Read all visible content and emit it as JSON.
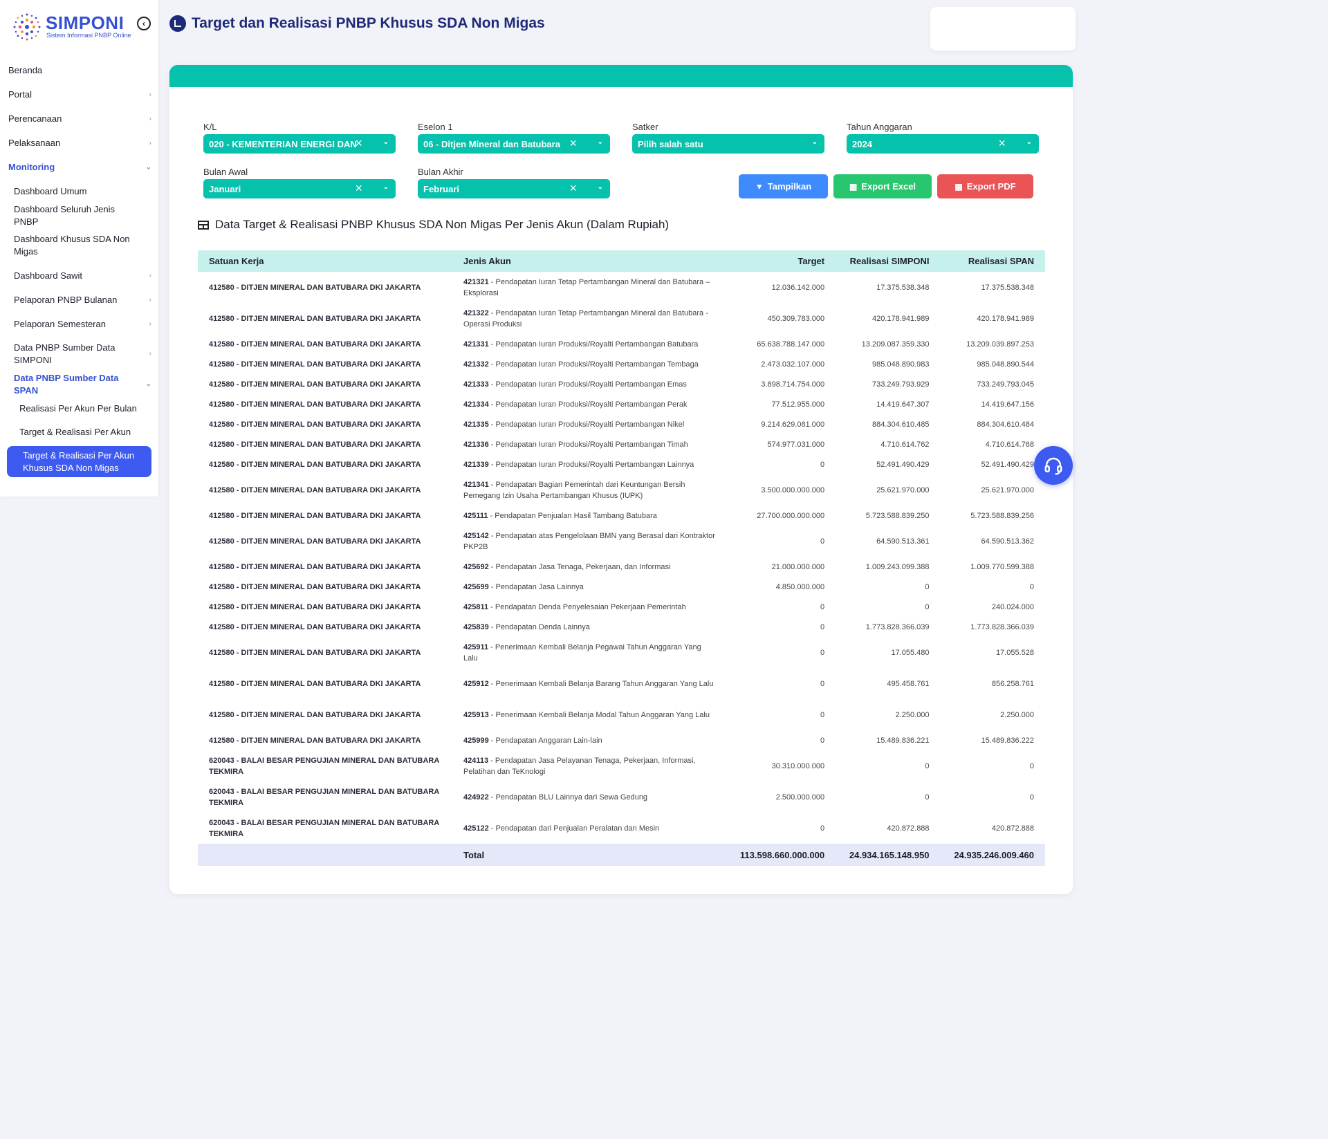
{
  "brand": {
    "name": "SIMPONI",
    "subtitle": "Sistem Informasi PNBP Online"
  },
  "sidebar": {
    "items": [
      {
        "label": "Beranda"
      },
      {
        "label": "Portal"
      },
      {
        "label": "Perencanaan"
      },
      {
        "label": "Pelaksanaan"
      },
      {
        "label": "Monitoring"
      }
    ],
    "monitoring": [
      {
        "label": "Dashboard Umum"
      },
      {
        "label": "Dashboard Seluruh Jenis PNBP"
      },
      {
        "label": "Dashboard Khusus SDA Non Migas"
      },
      {
        "label": "Dashboard Sawit"
      },
      {
        "label": "Pelaporan PNBP Bulanan"
      },
      {
        "label": "Pelaporan Semesteran"
      },
      {
        "label": "Data PNBP Sumber Data SIMPONI"
      },
      {
        "label": "Data PNBP Sumber Data SPAN"
      }
    ],
    "span": [
      {
        "label": "Realisasi Per Akun Per Bulan"
      },
      {
        "label": "Target & Realisasi Per Akun"
      },
      {
        "label": "Target & Realisasi Per Akun Khusus SDA Non Migas"
      }
    ]
  },
  "page": {
    "title": "Target dan Realisasi PNBP Khusus SDA Non Migas"
  },
  "filters": {
    "kl": {
      "label": "K/L",
      "value": "020 - KEMENTERIAN ENERGI DAN"
    },
    "eselon": {
      "label": "Eselon 1",
      "value": "06 - Ditjen Mineral dan Batubara"
    },
    "satker": {
      "label": "Satker",
      "value": "Pilih salah satu"
    },
    "tahun": {
      "label": "Tahun Anggaran",
      "value": "2024"
    },
    "bulan_awal": {
      "label": "Bulan Awal",
      "value": "Januari"
    },
    "bulan_akhir": {
      "label": "Bulan Akhir",
      "value": "Februari"
    }
  },
  "buttons": {
    "tampilkan": "Tampilkan",
    "excel": "Export Excel",
    "pdf": "Export PDF"
  },
  "section_title": "Data Target & Realisasi PNBP Khusus SDA Non Migas Per Jenis Akun (Dalam Rupiah)",
  "table": {
    "headers": [
      "Satuan Kerja",
      "Jenis Akun",
      "Target",
      "Realisasi SIMPONI",
      "Realisasi SPAN"
    ],
    "rows": [
      {
        "sk": "412580 - DITJEN MINERAL DAN BATUBARA DKI JAKARTA",
        "code": "421321",
        "name": "Pendapatan Iuran Tetap Pertambangan Mineral dan Batubara – Eksplorasi",
        "target": "12.036.142.000",
        "simponi": "17.375.538.348",
        "span": "17.375.538.348",
        "h": 45
      },
      {
        "sk": "412580 - DITJEN MINERAL DAN BATUBARA DKI JAKARTA",
        "code": "421322",
        "name": "Pendapatan Iuran Tetap Pertambangan Mineral dan Batubara - Operasi Produksi",
        "target": "450.309.783.000",
        "simponi": "420.178.941.989",
        "span": "420.178.941.989",
        "h": 45
      },
      {
        "sk": "412580 - DITJEN MINERAL DAN BATUBARA DKI JAKARTA",
        "code": "421331",
        "name": "Pendapatan Iuran Produksi/Royalti Pertambangan Batubara",
        "target": "65.638.788.147.000",
        "simponi": "13.209.087.359.330",
        "span": "13.209.039.897.253",
        "h": 29
      },
      {
        "sk": "412580 - DITJEN MINERAL DAN BATUBARA DKI JAKARTA",
        "code": "421332",
        "name": "Pendapatan Iuran Produksi/Royalti Pertambangan Tembaga",
        "target": "2.473.032.107.000",
        "simponi": "985.048.890.983",
        "span": "985.048.890.544",
        "h": 29
      },
      {
        "sk": "412580 - DITJEN MINERAL DAN BATUBARA DKI JAKARTA",
        "code": "421333",
        "name": "Pendapatan Iuran Produksi/Royalti Pertambangan Emas",
        "target": "3.898.714.754.000",
        "simponi": "733.249.793.929",
        "span": "733.249.793.045",
        "h": 29
      },
      {
        "sk": "412580 - DITJEN MINERAL DAN BATUBARA DKI JAKARTA",
        "code": "421334",
        "name": "Pendapatan Iuran Produksi/Royalti Pertambangan Perak",
        "target": "77.512.955.000",
        "simponi": "14.419.647.307",
        "span": "14.419.647.156",
        "h": 29
      },
      {
        "sk": "412580 - DITJEN MINERAL DAN BATUBARA DKI JAKARTA",
        "code": "421335",
        "name": "Pendapatan Iuran Produksi/Royalti Pertambangan Nikel",
        "target": "9.214.629.081.000",
        "simponi": "884.304.610.485",
        "span": "884.304.610.484",
        "h": 29
      },
      {
        "sk": "412580 - DITJEN MINERAL DAN BATUBARA DKI JAKARTA",
        "code": "421336",
        "name": "Pendapatan Iuran Produksi/Royalti Pertambangan Timah",
        "target": "574.977.031.000",
        "simponi": "4.710.614.762",
        "span": "4.710.614.768",
        "h": 29
      },
      {
        "sk": "412580 - DITJEN MINERAL DAN BATUBARA DKI JAKARTA",
        "code": "421339",
        "name": "Pendapatan Iuran Produksi/Royalti Pertambangan Lainnya",
        "target": "0",
        "simponi": "52.491.490.429",
        "span": "52.491.490.429",
        "h": 29
      },
      {
        "sk": "412580 - DITJEN MINERAL DAN BATUBARA DKI JAKARTA",
        "code": "421341",
        "name": "Pendapatan Bagian Pemerintah dari Keuntungan Bersih Pemegang Izin Usaha Pertambangan Khusus (IUPK)",
        "target": "3.500.000.000.000",
        "simponi": "25.621.970.000",
        "span": "25.621.970.000",
        "h": 45
      },
      {
        "sk": "412580 - DITJEN MINERAL DAN BATUBARA DKI JAKARTA",
        "code": "425111",
        "name": "Pendapatan Penjualan Hasil Tambang Batubara",
        "target": "27.700.000.000.000",
        "simponi": "5.723.588.839.250",
        "span": "5.723.588.839.256",
        "h": 29
      },
      {
        "sk": "412580 - DITJEN MINERAL DAN BATUBARA DKI JAKARTA",
        "code": "425142",
        "name": "Pendapatan atas Pengelolaan BMN yang Berasal dari Kontraktor PKP2B",
        "target": "0",
        "simponi": "64.590.513.361",
        "span": "64.590.513.362",
        "h": 45
      },
      {
        "sk": "412580 - DITJEN MINERAL DAN BATUBARA DKI JAKARTA",
        "code": "425692",
        "name": "Pendapatan Jasa Tenaga, Pekerjaan, dan Informasi",
        "target": "21.000.000.000",
        "simponi": "1.009.243.099.388",
        "span": "1.009.770.599.388",
        "h": 29
      },
      {
        "sk": "412580 - DITJEN MINERAL DAN BATUBARA DKI JAKARTA",
        "code": "425699",
        "name": "Pendapatan Jasa Lainnya",
        "target": "4.850.000.000",
        "simponi": "0",
        "span": "0",
        "h": 29
      },
      {
        "sk": "412580 - DITJEN MINERAL DAN BATUBARA DKI JAKARTA",
        "code": "425811",
        "name": "Pendapatan Denda Penyelesaian Pekerjaan Pemerintah",
        "target": "0",
        "simponi": "0",
        "span": "240.024.000",
        "h": 29
      },
      {
        "sk": "412580 - DITJEN MINERAL DAN BATUBARA DKI JAKARTA",
        "code": "425839",
        "name": "Pendapatan Denda Lainnya",
        "target": "0",
        "simponi": "1.773.828.366.039",
        "span": "1.773.828.366.039",
        "h": 29
      },
      {
        "sk": "412580 - DITJEN MINERAL DAN BATUBARA DKI JAKARTA",
        "code": "425911",
        "name": "Penerimaan Kembali Belanja Pegawai Tahun Anggaran Yang Lalu",
        "target": "0",
        "simponi": "17.055.480",
        "span": "17.055.528",
        "h": 45
      },
      {
        "sk": "412580 - DITJEN MINERAL DAN BATUBARA DKI JAKARTA",
        "code": "425912",
        "name": "Penerimaan Kembali Belanja Barang Tahun Anggaran Yang Lalu",
        "target": "0",
        "simponi": "495.458.761",
        "span": "856.258.761",
        "h": 45
      },
      {
        "sk": "412580 - DITJEN MINERAL DAN BATUBARA DKI JAKARTA",
        "code": "425913",
        "name": "Penerimaan Kembali Belanja Modal Tahun Anggaran Yang Lalu",
        "target": "0",
        "simponi": "2.250.000",
        "span": "2.250.000",
        "h": 45
      },
      {
        "sk": "412580 - DITJEN MINERAL DAN BATUBARA DKI JAKARTA",
        "code": "425999",
        "name": "Pendapatan Anggaran Lain-lain",
        "target": "0",
        "simponi": "15.489.836.221",
        "span": "15.489.836.222",
        "h": 29
      },
      {
        "sk": "620043 - BALAI BESAR PENGUJIAN MINERAL DAN BATUBARA TEKMIRA",
        "code": "424113",
        "name": "Pendapatan Jasa Pelayanan Tenaga, Pekerjaan, Informasi, Pelatihan dan TeKnologi",
        "target": "30.310.000.000",
        "simponi": "0",
        "span": "0",
        "h": 45
      },
      {
        "sk": "620043 - BALAI BESAR PENGUJIAN MINERAL DAN BATUBARA TEKMIRA",
        "code": "424922",
        "name": "Pendapatan BLU Lainnya dari Sewa Gedung",
        "target": "2.500.000.000",
        "simponi": "0",
        "span": "0",
        "h": 45
      },
      {
        "sk": "620043 - BALAI BESAR PENGUJIAN MINERAL DAN BATUBARA TEKMIRA",
        "code": "425122",
        "name": "Pendapatan dari Penjualan Peralatan dan Mesin",
        "target": "0",
        "simponi": "420.872.888",
        "span": "420.872.888",
        "h": 45
      }
    ],
    "total": {
      "label": "Total",
      "target": "113.598.660.000.000",
      "simponi": "24.934.165.148.950",
      "span": "24.935.246.009.460"
    }
  }
}
